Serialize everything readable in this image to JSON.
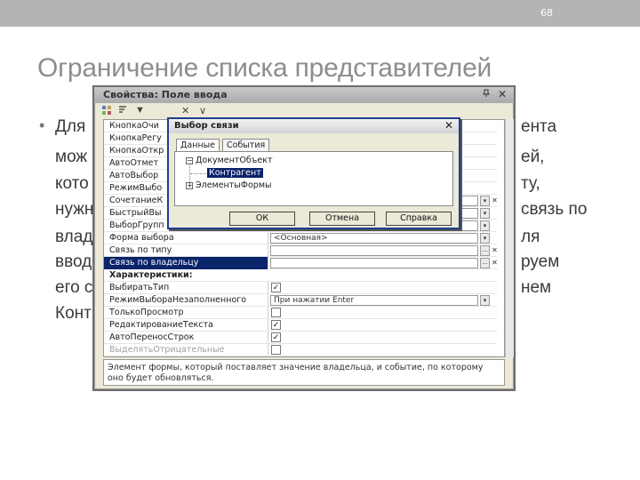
{
  "slide": {
    "page_number": "68",
    "title": "Ограничение списка представителей",
    "bullet_symbol": "•",
    "bullet_lines": [
      {
        "left": "Для",
        "right": "ента"
      },
      {
        "left": "мож",
        "right": "ей,"
      },
      {
        "left": "кото",
        "right": "ту,"
      },
      {
        "left": "нужн",
        "right": "связь по"
      },
      {
        "left": "влад",
        "right": "ля"
      },
      {
        "left": "ввод",
        "right": "руем"
      },
      {
        "left": "его с",
        "right": "нем"
      },
      {
        "left": "Конт",
        "right": ""
      }
    ]
  },
  "properties_window": {
    "title": "Свойства: Поле ввода",
    "pin_icon": "pin-icon",
    "close_symbol": "✕",
    "toolbar": {
      "filter_icon": "▼",
      "clear_icon": "✕",
      "down_icon": "∨"
    },
    "rows": [
      {
        "name": "КнопкаОчи",
        "type": "check",
        "value": "✓"
      },
      {
        "name": "КнопкаРегу",
        "type": "check",
        "value": ""
      },
      {
        "name": "КнопкаОткр",
        "type": "check",
        "value": ""
      },
      {
        "name": "АвтоОтмет",
        "type": "check",
        "value": ""
      },
      {
        "name": "АвтоВыбор",
        "type": "check",
        "value": ""
      },
      {
        "name": "РежимВыбо",
        "type": "check",
        "value": ""
      },
      {
        "name": "СочетаниеК",
        "type": "field",
        "value": "",
        "dd": "▾",
        "x": "✕"
      },
      {
        "name": "БыстрыйВы",
        "type": "field",
        "value": "",
        "dd": "▾"
      },
      {
        "name": "ВыборГрупп",
        "type": "field",
        "value": "",
        "dd": "▾"
      },
      {
        "name": "Форма выбора",
        "type": "field",
        "value": "<Основная>",
        "dd": "▾"
      },
      {
        "name": "Связь по типу",
        "type": "field",
        "value": "",
        "dots": "...",
        "x": "✕"
      },
      {
        "name": "Связь по владельцу",
        "type": "field",
        "value": "",
        "dots": "...",
        "x": "✕",
        "selected": true
      },
      {
        "name": "Характеристики:",
        "type": "section",
        "value": ""
      },
      {
        "name": "ВыбиратьТип",
        "type": "check",
        "value": "✓"
      },
      {
        "name": "РежимВыбораНезаполненного",
        "type": "field",
        "value": "При нажатии Enter",
        "dd": "▾"
      },
      {
        "name": "ТолькоПросмотр",
        "type": "check",
        "value": ""
      },
      {
        "name": "РедактированиеТекста",
        "type": "check",
        "value": "✓"
      },
      {
        "name": "АвтоПереносСтрок",
        "type": "check",
        "value": "✓"
      },
      {
        "name": "ВыделятьОтрицательные",
        "type": "check",
        "value": "",
        "disabled": true
      }
    ],
    "description": "Элемент формы, который поставляет значение владельца, и событие, по которому оно будет обновляться."
  },
  "dialog": {
    "title": "Выбор связи",
    "close_symbol": "✕",
    "tabs": [
      "Данные",
      "События"
    ],
    "tree": {
      "root": "ДокументОбъект",
      "root_toggle": "−",
      "child": "Контрагент",
      "sibling": "ЭлементыФормы",
      "sibling_toggle": "+"
    },
    "buttons": {
      "ok": "ОК",
      "cancel": "Отмена",
      "help": "Справка"
    }
  }
}
